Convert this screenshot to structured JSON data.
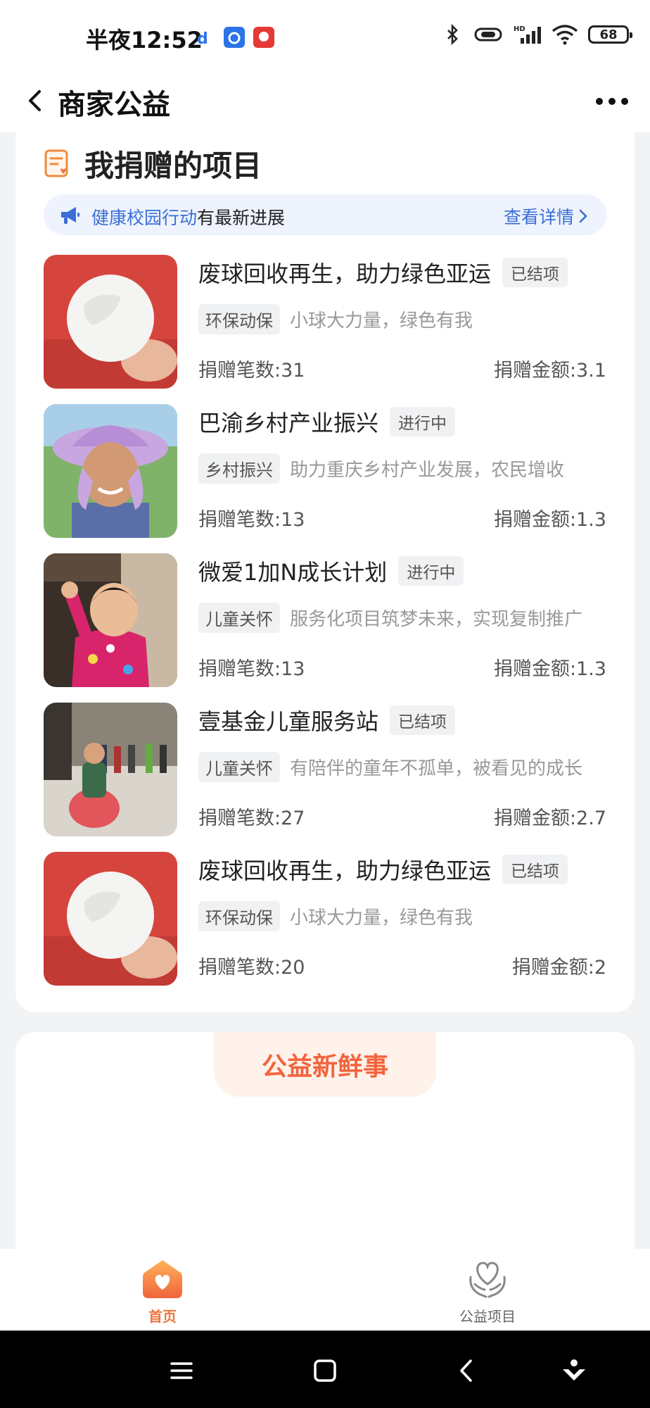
{
  "status_bar": {
    "time": "半夜12:52",
    "battery": "68",
    "icons": [
      "notification-app-icon",
      "notification-app-icon-2",
      "notification-app-icon-3",
      "bluetooth-icon",
      "vibrate-icon",
      "hd-signal-icon",
      "wifi-icon",
      "battery-icon"
    ]
  },
  "nav": {
    "title": "商家公益",
    "back_icon": "chevron-left-icon",
    "more_icon": "more-dots-icon"
  },
  "section": {
    "title": "我捐赠的项目",
    "icon": "document-heart-icon"
  },
  "notice": {
    "icon": "megaphone-icon",
    "link_text": "健康校园行动",
    "suffix_text": "有最新进展",
    "detail_label": "查看详情"
  },
  "items": [
    {
      "title": "废球回收再生，助力绿色亚运",
      "status": "已结项",
      "tag": "环保动保",
      "desc": "小球大力量，绿色有我",
      "count": "捐赠笔数:31",
      "amount": "捐赠金额:3.1"
    },
    {
      "title": "巴渝乡村产业振兴",
      "status": "进行中",
      "tag": "乡村振兴",
      "desc": "助力重庆乡村产业发展，农民增收",
      "count": "捐赠笔数:13",
      "amount": "捐赠金额:1.3"
    },
    {
      "title": "微爱1加N成长计划",
      "status": "进行中",
      "tag": "儿童关怀",
      "desc": "服务化项目筑梦未来，实现复制推广",
      "count": "捐赠笔数:13",
      "amount": "捐赠金额:1.3"
    },
    {
      "title": "壹基金儿童服务站",
      "status": "已结项",
      "tag": "儿童关怀",
      "desc": "有陪伴的童年不孤单，被看见的成长",
      "count": "捐赠笔数:27",
      "amount": "捐赠金额:2.7"
    },
    {
      "title": "废球回收再生，助力绿色亚运",
      "status": "已结项",
      "tag": "环保动保",
      "desc": "小球大力量，绿色有我",
      "count": "捐赠笔数:20",
      "amount": "捐赠金额:2"
    }
  ],
  "news": {
    "title": "公益新鲜事"
  },
  "tabbar": {
    "home_label": "首页",
    "projects_label": "公益项目"
  },
  "colors": {
    "accent_orange": "#f07540",
    "news_title": "#f2643f",
    "link_blue": "#3a6fd6"
  }
}
